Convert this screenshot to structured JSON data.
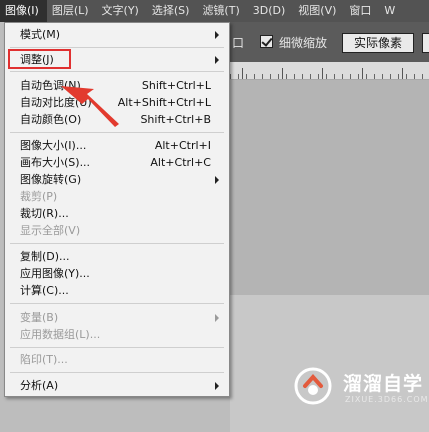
{
  "menubar": {
    "items": [
      {
        "label": "图像(I)",
        "active": true
      },
      {
        "label": "图层(L)"
      },
      {
        "label": "文字(Y)"
      },
      {
        "label": "选择(S)"
      },
      {
        "label": "滤镜(T)"
      },
      {
        "label": "3D(D)"
      },
      {
        "label": "视图(V)"
      },
      {
        "label": "窗口"
      },
      {
        "label": "W"
      }
    ]
  },
  "options": {
    "partial_label": "口",
    "checkbox_checked": true,
    "scrubby_zoom_label": "细微缩放",
    "actual_pixels_label": "实际像素"
  },
  "dropdown": {
    "items": [
      {
        "label": "模式(M)",
        "submenu": true
      },
      {
        "label": "调整(J)",
        "submenu": true
      },
      {
        "label": "自动色调(N)",
        "shortcut": "Shift+Ctrl+L"
      },
      {
        "label": "自动对比度(U)",
        "shortcut": "Alt+Shift+Ctrl+L"
      },
      {
        "label": "自动颜色(O)",
        "shortcut": "Shift+Ctrl+B"
      },
      {
        "label": "图像大小(I)...",
        "shortcut": "Alt+Ctrl+I"
      },
      {
        "label": "画布大小(S)...",
        "shortcut": "Alt+Ctrl+C"
      },
      {
        "label": "图像旋转(G)",
        "submenu": true
      },
      {
        "label": "裁剪(P)",
        "disabled": true
      },
      {
        "label": "裁切(R)..."
      },
      {
        "label": "显示全部(V)",
        "disabled": true
      },
      {
        "label": "复制(D)..."
      },
      {
        "label": "应用图像(Y)..."
      },
      {
        "label": "计算(C)..."
      },
      {
        "label": "变量(B)",
        "submenu": true,
        "disabled": true
      },
      {
        "label": "应用数据组(L)...",
        "disabled": true
      },
      {
        "label": "陷印(T)...",
        "disabled": true
      },
      {
        "label": "分析(A)",
        "submenu": true
      }
    ]
  },
  "watermark": {
    "title": "溜溜自学",
    "subtitle": "ZIXUE.3D66.COM"
  },
  "colors": {
    "menubar_bg": "#535353",
    "menu_bg": "#f2f2f2",
    "highlight_red": "#e03030",
    "watermark_bg": "#3a4a6e"
  }
}
